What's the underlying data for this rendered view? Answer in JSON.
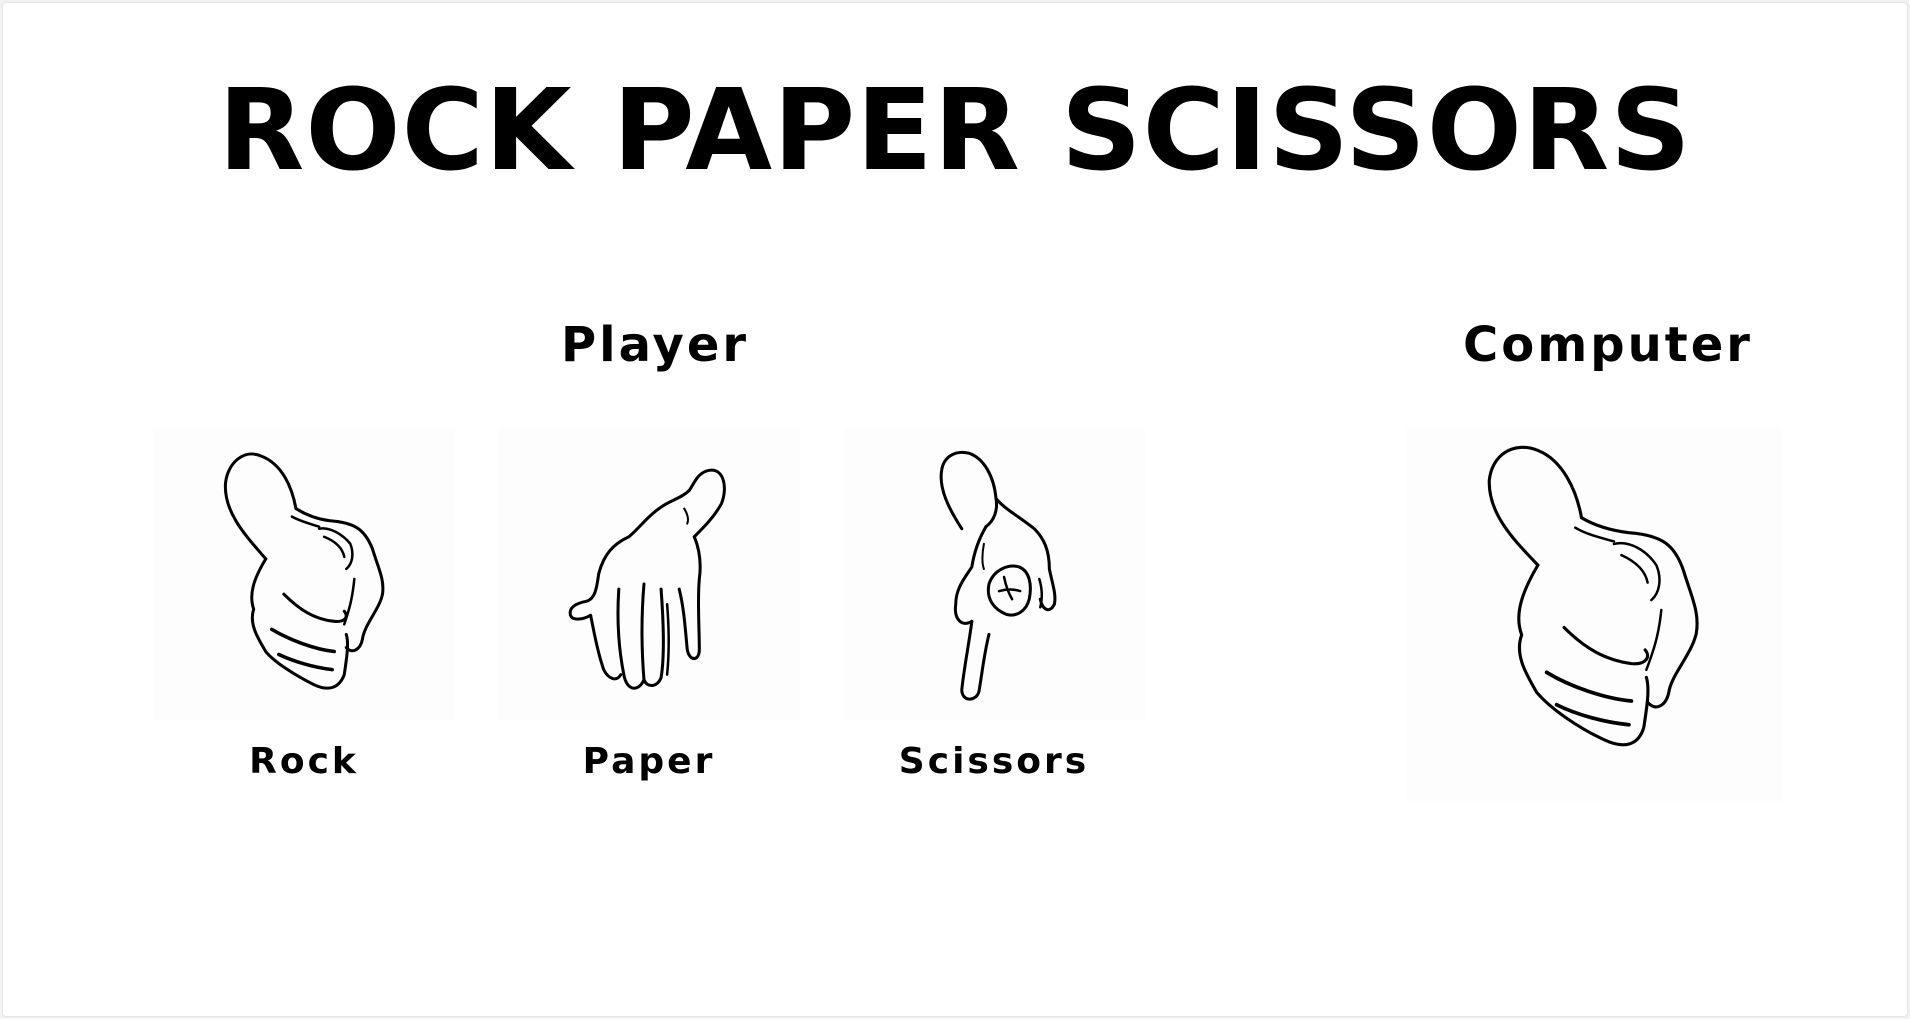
{
  "title": "ROCK PAPER SCISSORS",
  "player": {
    "label": "Player",
    "choices": [
      {
        "label": "Rock",
        "icon": "rock-hand-icon"
      },
      {
        "label": "Paper",
        "icon": "paper-hand-icon"
      },
      {
        "label": "Scissors",
        "icon": "scissors-hand-icon"
      }
    ]
  },
  "computer": {
    "label": "Computer",
    "choice_icon": "rock-hand-icon"
  },
  "colors": {
    "background": "#ffffff",
    "text": "#000000"
  }
}
